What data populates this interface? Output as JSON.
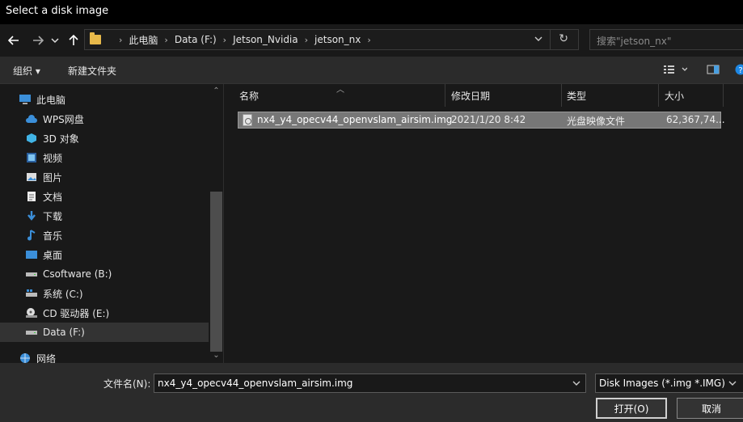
{
  "window": {
    "title": "Select a disk image"
  },
  "nav": {
    "back_icon": "arrow-left-icon",
    "forward_icon": "arrow-right-icon",
    "recent_icon": "chevron-down-icon",
    "up_icon": "arrow-up-icon",
    "breadcrumbs": [
      "此电脑",
      "Data (F:)",
      "Jetson_Nvidia",
      "jetson_nx"
    ],
    "search_placeholder": "搜索\"jetson_nx\""
  },
  "toolbar": {
    "organize": "组织 ▾",
    "new_folder": "新建文件夹"
  },
  "sidebar": {
    "items": [
      {
        "label": "此电脑",
        "icon": "computer-icon"
      },
      {
        "label": "WPS网盘",
        "icon": "cloud-icon"
      },
      {
        "label": "3D 对象",
        "icon": "cube-icon"
      },
      {
        "label": "视频",
        "icon": "video-icon"
      },
      {
        "label": "图片",
        "icon": "picture-icon"
      },
      {
        "label": "文档",
        "icon": "document-icon"
      },
      {
        "label": "下载",
        "icon": "download-icon"
      },
      {
        "label": "音乐",
        "icon": "music-icon"
      },
      {
        "label": "桌面",
        "icon": "desktop-icon"
      },
      {
        "label": "Csoftware (B:)",
        "icon": "drive-icon"
      },
      {
        "label": "系统 (C:)",
        "icon": "system-drive-icon"
      },
      {
        "label": "CD 驱动器 (E:)",
        "icon": "cd-drive-icon"
      },
      {
        "label": "Data (F:)",
        "icon": "drive-icon"
      },
      {
        "label": "网络",
        "icon": "network-icon"
      }
    ],
    "selected": "Data (F:)"
  },
  "columns": [
    "名称",
    "修改日期",
    "类型",
    "大小"
  ],
  "files": [
    {
      "name": "nx4_y4_opecv44_openvslam_airsim.img",
      "modified": "2021/1/20 8:42",
      "type": "光盘映像文件",
      "size": "62,367,74..."
    }
  ],
  "footer": {
    "filename_label": "文件名(N):",
    "filename_value": "nx4_y4_opecv44_openvslam_airsim.img",
    "filetype_value": "Disk Images (*.img *.IMG)",
    "open_label": "打开(O)",
    "cancel_label": "取消"
  }
}
